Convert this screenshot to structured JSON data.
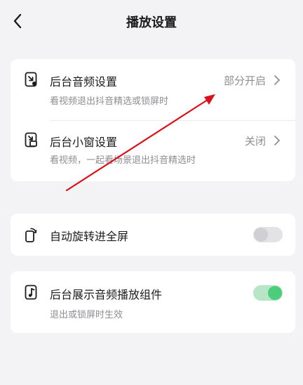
{
  "header": {
    "title": "播放设置",
    "back_icon": "chevron-left-icon"
  },
  "sections": {
    "background": {
      "audio": {
        "title": "后台音频设置",
        "subtitle": "看视频退出抖音精选或锁屏时",
        "value": "部分开启",
        "icon": "background-audio-icon"
      },
      "mini_window": {
        "title": "后台小窗设置",
        "subtitle": "看视频，一起看场景退出抖音精选时",
        "value": "关闭",
        "icon": "mini-window-icon"
      }
    },
    "auto_rotate": {
      "title": "自动旋转进全屏",
      "enabled": false,
      "icon": "rotate-phone-icon"
    },
    "audio_widget": {
      "title": "后台展示音频播放组件",
      "subtitle": "退出或锁屏时生效",
      "enabled": true,
      "icon": "music-widget-icon"
    }
  },
  "colors": {
    "background": "#f3f3f5",
    "card": "#ffffff",
    "toggle_on": "#4ccd7c",
    "toggle_off": "#d0d0d4",
    "annotation_arrow": "#d8121a"
  }
}
